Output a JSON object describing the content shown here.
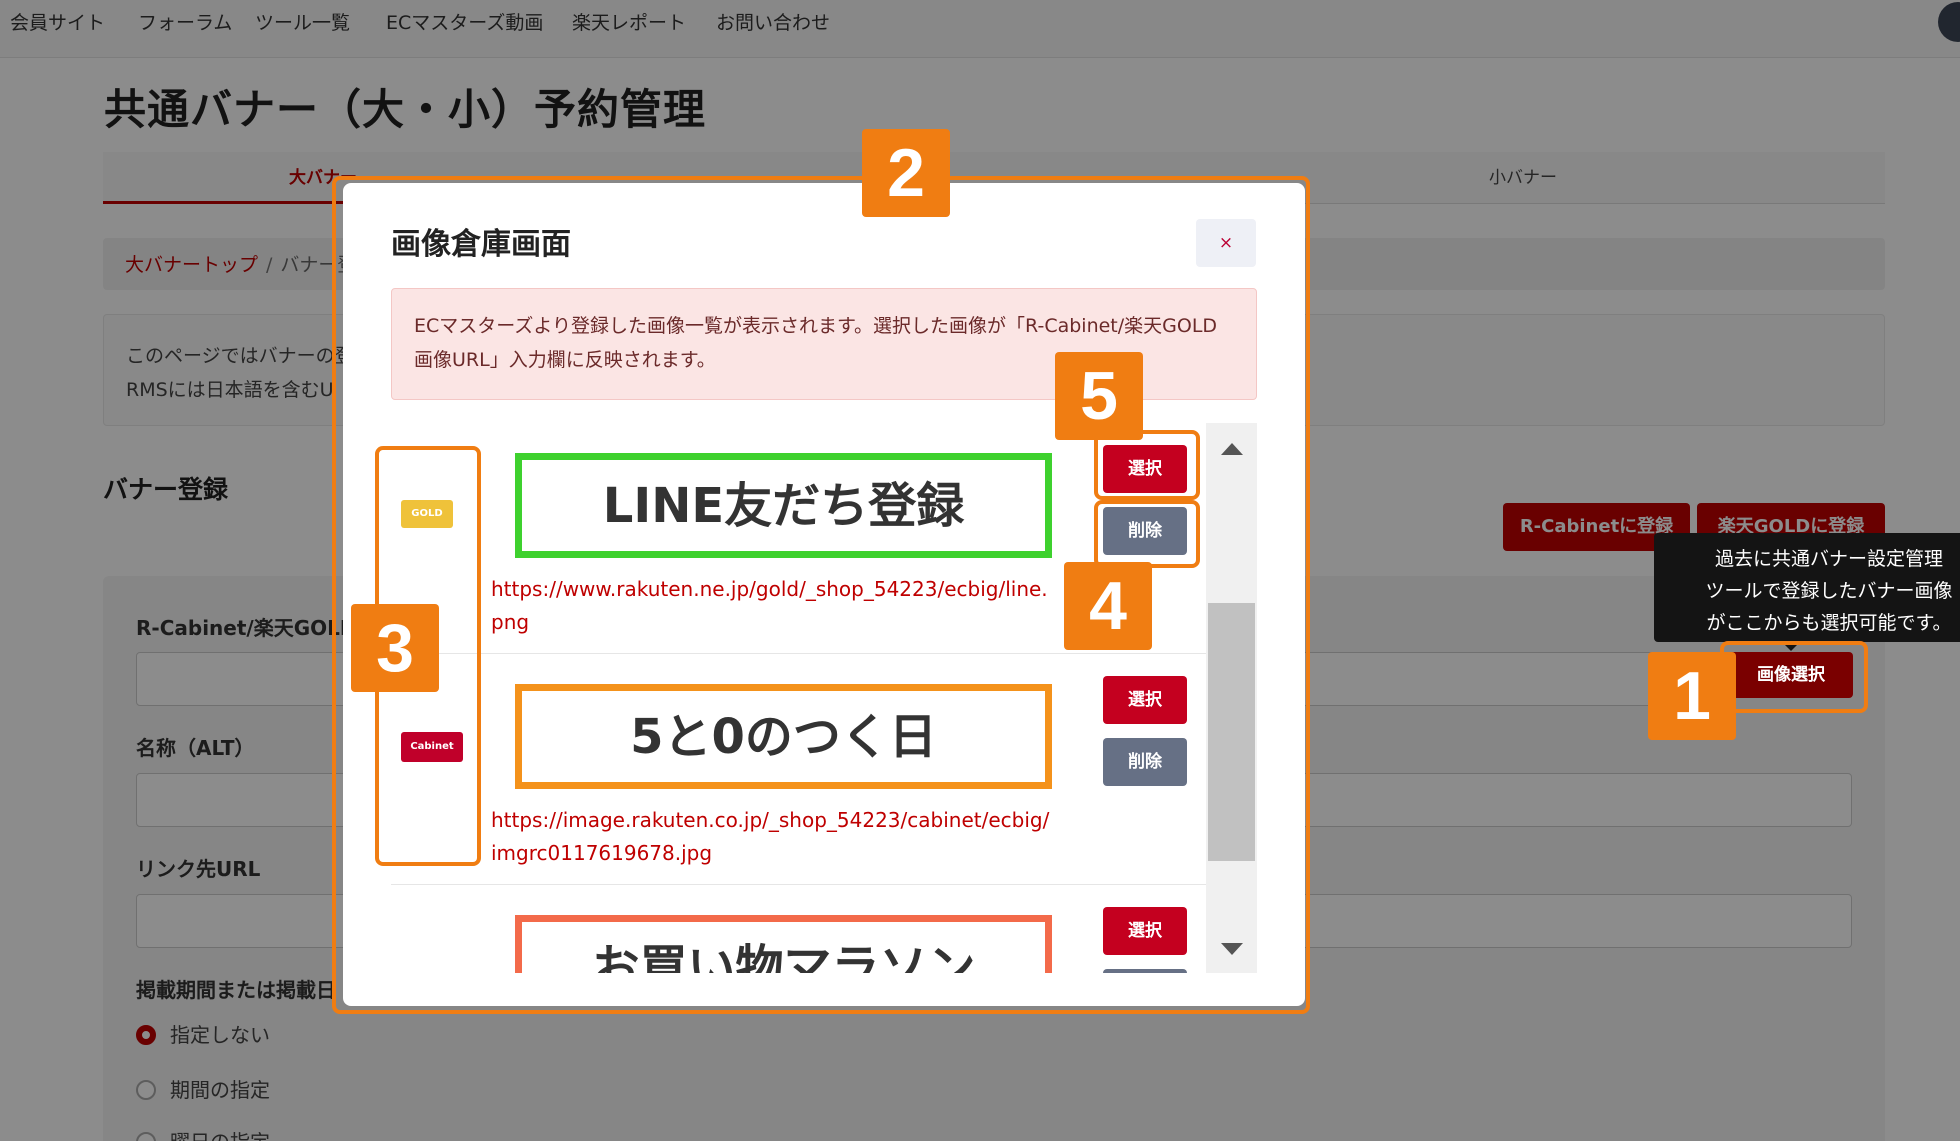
{
  "nav": {
    "items": [
      "会員サイト",
      "フォーラム",
      "ツール一覧",
      "ECマスターズ動画",
      "楽天レポート",
      "お問い合わせ"
    ]
  },
  "page": {
    "title": "共通バナー（大・小）予約管理",
    "tabs": [
      "大バナー",
      "小バナー"
    ],
    "breadcrumb": {
      "home": "大バナートップ",
      "sep": "/",
      "current": "バナー登録"
    },
    "info_lines": [
      "このページではバナーの登",
      "RMSには日本語を含むU"
    ],
    "section_heading": "バナー登録",
    "buttons": {
      "r_cabinet": "R-Cabinetに登録",
      "rakuten_gold": "楽天GOLDに登録",
      "image_select": "画像選択"
    },
    "tooltip": [
      "過去に共通バナー設定管理",
      "ツールで登録したバナー画像",
      "がここからも選択可能です。"
    ],
    "form": {
      "url_label": "R-Cabinet/楽天GOLD",
      "alt_label": "名称（ALT）",
      "link_label": "リンク先URL",
      "period_label": "掲載期間または掲載日",
      "radios": [
        "指定しない",
        "期間の指定",
        "曜日の指定"
      ]
    }
  },
  "modal": {
    "title": "画像倉庫画面",
    "close": "×",
    "alert": "ECマスターズより登録した画像一覧が表示されます。選択した画像が「R-Cabinet/楽天GOLD画像URL」入力欄に反映されます。",
    "rows": [
      {
        "badge": "GOLD",
        "banner": "LINE友だち登録",
        "url": "https://www.rakuten.ne.jp/gold/_shop_54223/ecbig/line.png",
        "select": "選択",
        "delete": "削除"
      },
      {
        "badge": "Cabinet",
        "banner": "5と0のつく日",
        "url": "https://image.rakuten.co.jp/_shop_54223/cabinet/ecbig/imgrc0117619678.jpg",
        "select": "選択",
        "delete": "削除"
      },
      {
        "banner": "お買い物マラソン",
        "select": "選択"
      }
    ]
  },
  "annotations": {
    "n1": "1",
    "n2": "2",
    "n3": "3",
    "n4": "4",
    "n5": "5"
  },
  "colors": {
    "accent": "#bf0000",
    "annotation": "#f07d12",
    "delete_btn": "#667085"
  }
}
